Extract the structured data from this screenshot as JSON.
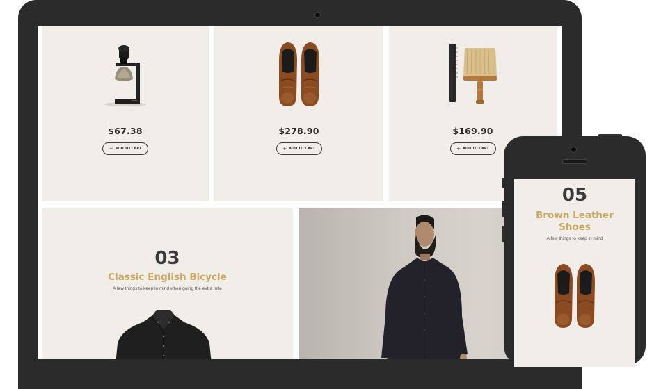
{
  "products": [
    {
      "name": "shaving-brush",
      "price": "$67.38",
      "button_label": "ADD TO CART"
    },
    {
      "name": "brogue-shoes",
      "price": "$278.90",
      "button_label": "ADD TO CART"
    },
    {
      "name": "comb-and-brush",
      "price": "$169.90",
      "button_label": "ADD TO CART"
    }
  ],
  "cart_icon": "+",
  "feature": {
    "number": "03",
    "title": "Classic English Bicycle",
    "subtitle": "A few things to keep in mind when going the extra mile"
  },
  "phone_feature": {
    "number": "05",
    "title_line1": "Brown Leather",
    "title_line2": "Shoes",
    "subtitle": "A few things to keep in mind"
  },
  "colors": {
    "accent_gold": "#c9a961",
    "card_bg": "#f1eeea",
    "device": "#2b2b2b"
  }
}
